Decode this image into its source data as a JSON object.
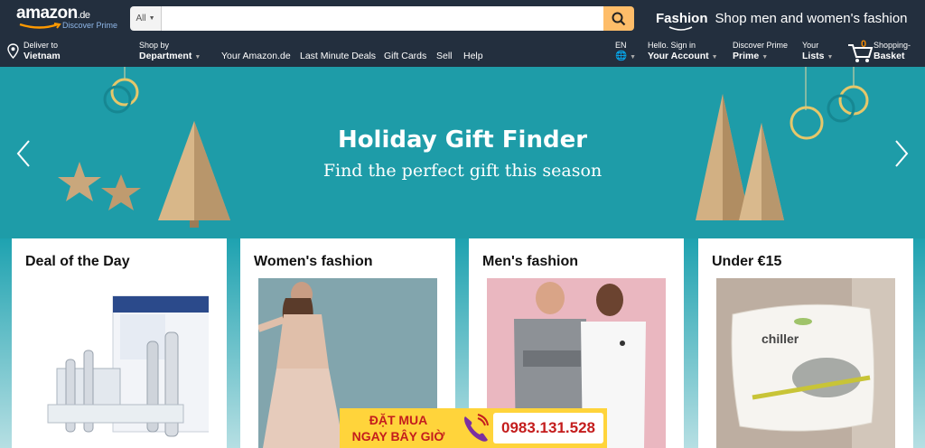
{
  "header": {
    "logo_text": "amazon",
    "logo_tld": ".de",
    "logo_sub": "Discover Prime",
    "search": {
      "category": "All",
      "placeholder": "",
      "button_icon": "search-icon"
    },
    "promo": {
      "brand": "Fashion",
      "text": "Shop men and women's fashion"
    }
  },
  "nav": {
    "deliver": {
      "small": "Deliver to",
      "big": "Vietnam"
    },
    "department": {
      "small": "Shop by",
      "big": "Department"
    },
    "links": [
      "Your Amazon.de",
      "Last Minute Deals",
      "Gift Cards",
      "Sell",
      "Help"
    ],
    "lang": "EN",
    "account": {
      "small": "Hello. Sign in",
      "big": "Your Account"
    },
    "prime": {
      "small": "Discover Prime",
      "big": "Prime"
    },
    "lists": {
      "small": "Your",
      "big": "Lists"
    },
    "basket": {
      "count": "0",
      "small": "Shopping-",
      "big": "Basket"
    }
  },
  "hero": {
    "title": "Holiday Gift Finder",
    "subtitle": "Find the perfect gift this season"
  },
  "cards": [
    {
      "title": "Deal of the Day",
      "image": "toothbrush-product-image"
    },
    {
      "title": "Women's fashion",
      "image": "women-fashion-image"
    },
    {
      "title": "Men's fashion",
      "image": "men-fashion-image"
    },
    {
      "title": "Under €15",
      "image": "pillow-image"
    }
  ],
  "overlay_banner": {
    "line1": "ĐẶT MUA",
    "line2": "NGAY BÂY GIỜ",
    "phone": "0983.131.528"
  },
  "colors": {
    "nav_bg": "#232f3e",
    "search_button": "#febd69",
    "hero_bg": "#1e9ca8",
    "banner_bg": "#ffd43b",
    "banner_text": "#c41d1d"
  }
}
